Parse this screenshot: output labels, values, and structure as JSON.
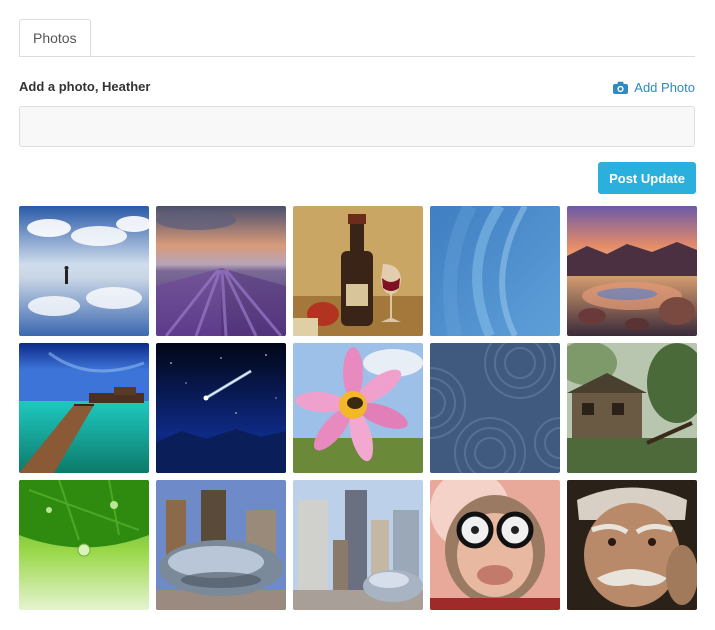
{
  "tabs": [
    {
      "label": "Photos"
    }
  ],
  "compose": {
    "prompt": "Add a photo, Heather",
    "add_photo_label": "Add Photo",
    "input_value": "",
    "post_button_label": "Post Update"
  },
  "colors": {
    "accent": "#2bb0dd",
    "link": "#2e8ac0"
  },
  "gallery": {
    "photos": [
      {
        "subject": "salt-flat-reflection"
      },
      {
        "subject": "lavender-field-sunset"
      },
      {
        "subject": "wine-bottle-painting"
      },
      {
        "subject": "blue-abstract-wallpaper"
      },
      {
        "subject": "rocky-lake-sunset"
      },
      {
        "subject": "tropical-pier"
      },
      {
        "subject": "comet-night-sky"
      },
      {
        "subject": "pink-flower-bee"
      },
      {
        "subject": "blue-circle-pattern"
      },
      {
        "subject": "abandoned-house-forest"
      },
      {
        "subject": "green-leaf-water-drop"
      },
      {
        "subject": "cloud-gate-bean"
      },
      {
        "subject": "chicago-skyline-bean"
      },
      {
        "subject": "monkey-with-glasses"
      },
      {
        "subject": "old-man-portrait"
      }
    ]
  }
}
